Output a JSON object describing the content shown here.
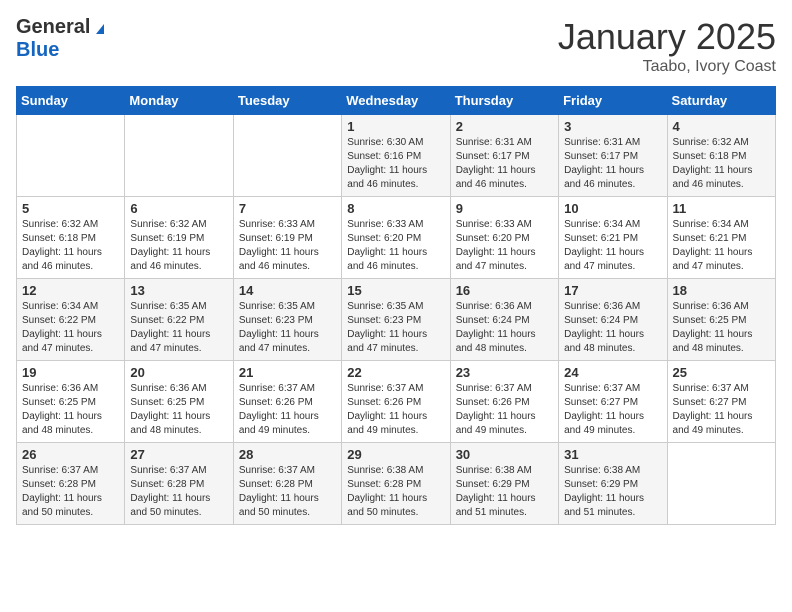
{
  "logo": {
    "general": "General",
    "blue": "Blue"
  },
  "header": {
    "month": "January 2025",
    "location": "Taabo, Ivory Coast"
  },
  "days_of_week": [
    "Sunday",
    "Monday",
    "Tuesday",
    "Wednesday",
    "Thursday",
    "Friday",
    "Saturday"
  ],
  "weeks": [
    [
      {
        "day": "",
        "info": ""
      },
      {
        "day": "",
        "info": ""
      },
      {
        "day": "",
        "info": ""
      },
      {
        "day": "1",
        "info": "Sunrise: 6:30 AM\nSunset: 6:16 PM\nDaylight: 11 hours\nand 46 minutes."
      },
      {
        "day": "2",
        "info": "Sunrise: 6:31 AM\nSunset: 6:17 PM\nDaylight: 11 hours\nand 46 minutes."
      },
      {
        "day": "3",
        "info": "Sunrise: 6:31 AM\nSunset: 6:17 PM\nDaylight: 11 hours\nand 46 minutes."
      },
      {
        "day": "4",
        "info": "Sunrise: 6:32 AM\nSunset: 6:18 PM\nDaylight: 11 hours\nand 46 minutes."
      }
    ],
    [
      {
        "day": "5",
        "info": "Sunrise: 6:32 AM\nSunset: 6:18 PM\nDaylight: 11 hours\nand 46 minutes."
      },
      {
        "day": "6",
        "info": "Sunrise: 6:32 AM\nSunset: 6:19 PM\nDaylight: 11 hours\nand 46 minutes."
      },
      {
        "day": "7",
        "info": "Sunrise: 6:33 AM\nSunset: 6:19 PM\nDaylight: 11 hours\nand 46 minutes."
      },
      {
        "day": "8",
        "info": "Sunrise: 6:33 AM\nSunset: 6:20 PM\nDaylight: 11 hours\nand 46 minutes."
      },
      {
        "day": "9",
        "info": "Sunrise: 6:33 AM\nSunset: 6:20 PM\nDaylight: 11 hours\nand 47 minutes."
      },
      {
        "day": "10",
        "info": "Sunrise: 6:34 AM\nSunset: 6:21 PM\nDaylight: 11 hours\nand 47 minutes."
      },
      {
        "day": "11",
        "info": "Sunrise: 6:34 AM\nSunset: 6:21 PM\nDaylight: 11 hours\nand 47 minutes."
      }
    ],
    [
      {
        "day": "12",
        "info": "Sunrise: 6:34 AM\nSunset: 6:22 PM\nDaylight: 11 hours\nand 47 minutes."
      },
      {
        "day": "13",
        "info": "Sunrise: 6:35 AM\nSunset: 6:22 PM\nDaylight: 11 hours\nand 47 minutes."
      },
      {
        "day": "14",
        "info": "Sunrise: 6:35 AM\nSunset: 6:23 PM\nDaylight: 11 hours\nand 47 minutes."
      },
      {
        "day": "15",
        "info": "Sunrise: 6:35 AM\nSunset: 6:23 PM\nDaylight: 11 hours\nand 47 minutes."
      },
      {
        "day": "16",
        "info": "Sunrise: 6:36 AM\nSunset: 6:24 PM\nDaylight: 11 hours\nand 48 minutes."
      },
      {
        "day": "17",
        "info": "Sunrise: 6:36 AM\nSunset: 6:24 PM\nDaylight: 11 hours\nand 48 minutes."
      },
      {
        "day": "18",
        "info": "Sunrise: 6:36 AM\nSunset: 6:25 PM\nDaylight: 11 hours\nand 48 minutes."
      }
    ],
    [
      {
        "day": "19",
        "info": "Sunrise: 6:36 AM\nSunset: 6:25 PM\nDaylight: 11 hours\nand 48 minutes."
      },
      {
        "day": "20",
        "info": "Sunrise: 6:36 AM\nSunset: 6:25 PM\nDaylight: 11 hours\nand 48 minutes."
      },
      {
        "day": "21",
        "info": "Sunrise: 6:37 AM\nSunset: 6:26 PM\nDaylight: 11 hours\nand 49 minutes."
      },
      {
        "day": "22",
        "info": "Sunrise: 6:37 AM\nSunset: 6:26 PM\nDaylight: 11 hours\nand 49 minutes."
      },
      {
        "day": "23",
        "info": "Sunrise: 6:37 AM\nSunset: 6:26 PM\nDaylight: 11 hours\nand 49 minutes."
      },
      {
        "day": "24",
        "info": "Sunrise: 6:37 AM\nSunset: 6:27 PM\nDaylight: 11 hours\nand 49 minutes."
      },
      {
        "day": "25",
        "info": "Sunrise: 6:37 AM\nSunset: 6:27 PM\nDaylight: 11 hours\nand 49 minutes."
      }
    ],
    [
      {
        "day": "26",
        "info": "Sunrise: 6:37 AM\nSunset: 6:28 PM\nDaylight: 11 hours\nand 50 minutes."
      },
      {
        "day": "27",
        "info": "Sunrise: 6:37 AM\nSunset: 6:28 PM\nDaylight: 11 hours\nand 50 minutes."
      },
      {
        "day": "28",
        "info": "Sunrise: 6:37 AM\nSunset: 6:28 PM\nDaylight: 11 hours\nand 50 minutes."
      },
      {
        "day": "29",
        "info": "Sunrise: 6:38 AM\nSunset: 6:28 PM\nDaylight: 11 hours\nand 50 minutes."
      },
      {
        "day": "30",
        "info": "Sunrise: 6:38 AM\nSunset: 6:29 PM\nDaylight: 11 hours\nand 51 minutes."
      },
      {
        "day": "31",
        "info": "Sunrise: 6:38 AM\nSunset: 6:29 PM\nDaylight: 11 hours\nand 51 minutes."
      },
      {
        "day": "",
        "info": ""
      }
    ]
  ]
}
